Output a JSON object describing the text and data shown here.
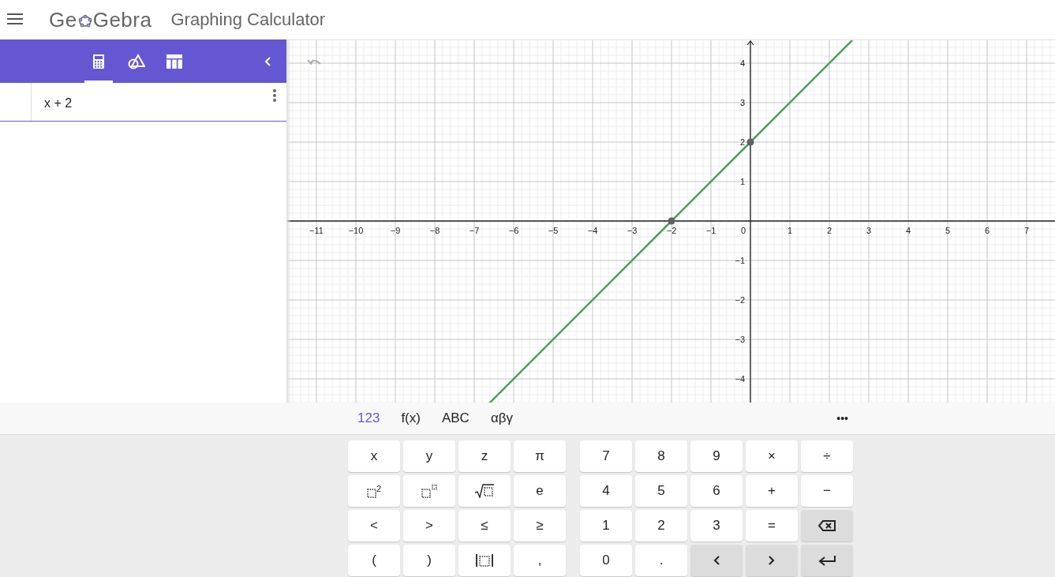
{
  "header": {
    "logo": {
      "before": "Ge",
      "after": "Gebra"
    },
    "title": "Graphing Calculator"
  },
  "sidebar": {
    "tabs": [
      {
        "kind": "calculator",
        "selected": true
      },
      {
        "kind": "geometry",
        "selected": false
      },
      {
        "kind": "table",
        "selected": false
      }
    ],
    "items": [
      {
        "expression": "x + 2"
      }
    ]
  },
  "graph": {
    "chart_data": {
      "type": "line",
      "x": [
        -6.62,
        -2,
        0,
        2.58
      ],
      "series": [
        {
          "color": "#559d5f",
          "values": [
            -4.62,
            0,
            2,
            4.58
          ]
        }
      ],
      "grid": true,
      "xlim": [
        -11.76,
        7.72
      ],
      "ylim": [
        -4.62,
        4.58
      ],
      "xticks": [
        {
          "value": -11,
          "label": "−11"
        },
        {
          "value": -10,
          "label": "−10"
        },
        {
          "value": -9,
          "label": "−9"
        },
        {
          "value": -8,
          "label": "−8"
        },
        {
          "value": -7,
          "label": "−7"
        },
        {
          "value": -6,
          "label": "−6"
        },
        {
          "value": -5,
          "label": "−5"
        },
        {
          "value": -4,
          "label": "−4"
        },
        {
          "value": -3,
          "label": "−3"
        },
        {
          "value": -2,
          "label": "−2"
        },
        {
          "value": -1,
          "label": "−1"
        },
        {
          "value": 1,
          "label": "1"
        },
        {
          "value": 2,
          "label": "2"
        },
        {
          "value": 3,
          "label": "3"
        },
        {
          "value": 4,
          "label": "4"
        },
        {
          "value": 5,
          "label": "5"
        },
        {
          "value": 6,
          "label": "6"
        },
        {
          "value": 7,
          "label": "7"
        }
      ],
      "yticks": [
        {
          "value": -4,
          "label": "−4"
        },
        {
          "value": -3,
          "label": "−3"
        },
        {
          "value": -2,
          "label": "−2"
        },
        {
          "value": -1,
          "label": "−1"
        },
        {
          "value": 1,
          "label": "1"
        },
        {
          "value": 2,
          "label": "2"
        },
        {
          "value": 3,
          "label": "3"
        },
        {
          "value": 4,
          "label": "4"
        }
      ]
    },
    "origin_label": "0"
  },
  "keyboard": {
    "tabs": [
      {
        "label": "123",
        "selected": true
      },
      {
        "label": "f(x)",
        "selected": false
      },
      {
        "label": "ABC",
        "selected": false
      },
      {
        "label": "αβγ",
        "selected": false
      }
    ],
    "more": "•••",
    "left_keys": [
      [
        {
          "kind": "text",
          "label": "x"
        },
        {
          "kind": "text",
          "label": "y"
        },
        {
          "kind": "text",
          "label": "z"
        },
        {
          "kind": "text",
          "label": "π"
        }
      ],
      [
        {
          "kind": "square",
          "label": "2"
        },
        {
          "kind": "power"
        },
        {
          "kind": "sqrt"
        },
        {
          "kind": "text",
          "label": "e"
        }
      ],
      [
        {
          "kind": "text",
          "label": "<"
        },
        {
          "kind": "text",
          "label": ">"
        },
        {
          "kind": "text",
          "label": "≤"
        },
        {
          "kind": "text",
          "label": "≥"
        }
      ],
      [
        {
          "kind": "text",
          "label": "("
        },
        {
          "kind": "text",
          "label": ")"
        },
        {
          "kind": "abs"
        },
        {
          "kind": "text",
          "label": ","
        }
      ]
    ],
    "right_keys": [
      [
        {
          "kind": "text",
          "label": "7"
        },
        {
          "kind": "text",
          "label": "8"
        },
        {
          "kind": "text",
          "label": "9"
        },
        {
          "kind": "text",
          "label": "×"
        },
        {
          "kind": "text",
          "label": "÷"
        }
      ],
      [
        {
          "kind": "text",
          "label": "4"
        },
        {
          "kind": "text",
          "label": "5"
        },
        {
          "kind": "text",
          "label": "6"
        },
        {
          "kind": "text",
          "label": "+"
        },
        {
          "kind": "text",
          "label": "−"
        }
      ],
      [
        {
          "kind": "text",
          "label": "1"
        },
        {
          "kind": "text",
          "label": "2"
        },
        {
          "kind": "text",
          "label": "3"
        },
        {
          "kind": "text",
          "label": "="
        },
        {
          "kind": "backspace"
        }
      ],
      [
        {
          "kind": "text",
          "label": "0"
        },
        {
          "kind": "text",
          "label": "."
        },
        {
          "kind": "left"
        },
        {
          "kind": "right"
        },
        {
          "kind": "enter"
        }
      ]
    ]
  }
}
